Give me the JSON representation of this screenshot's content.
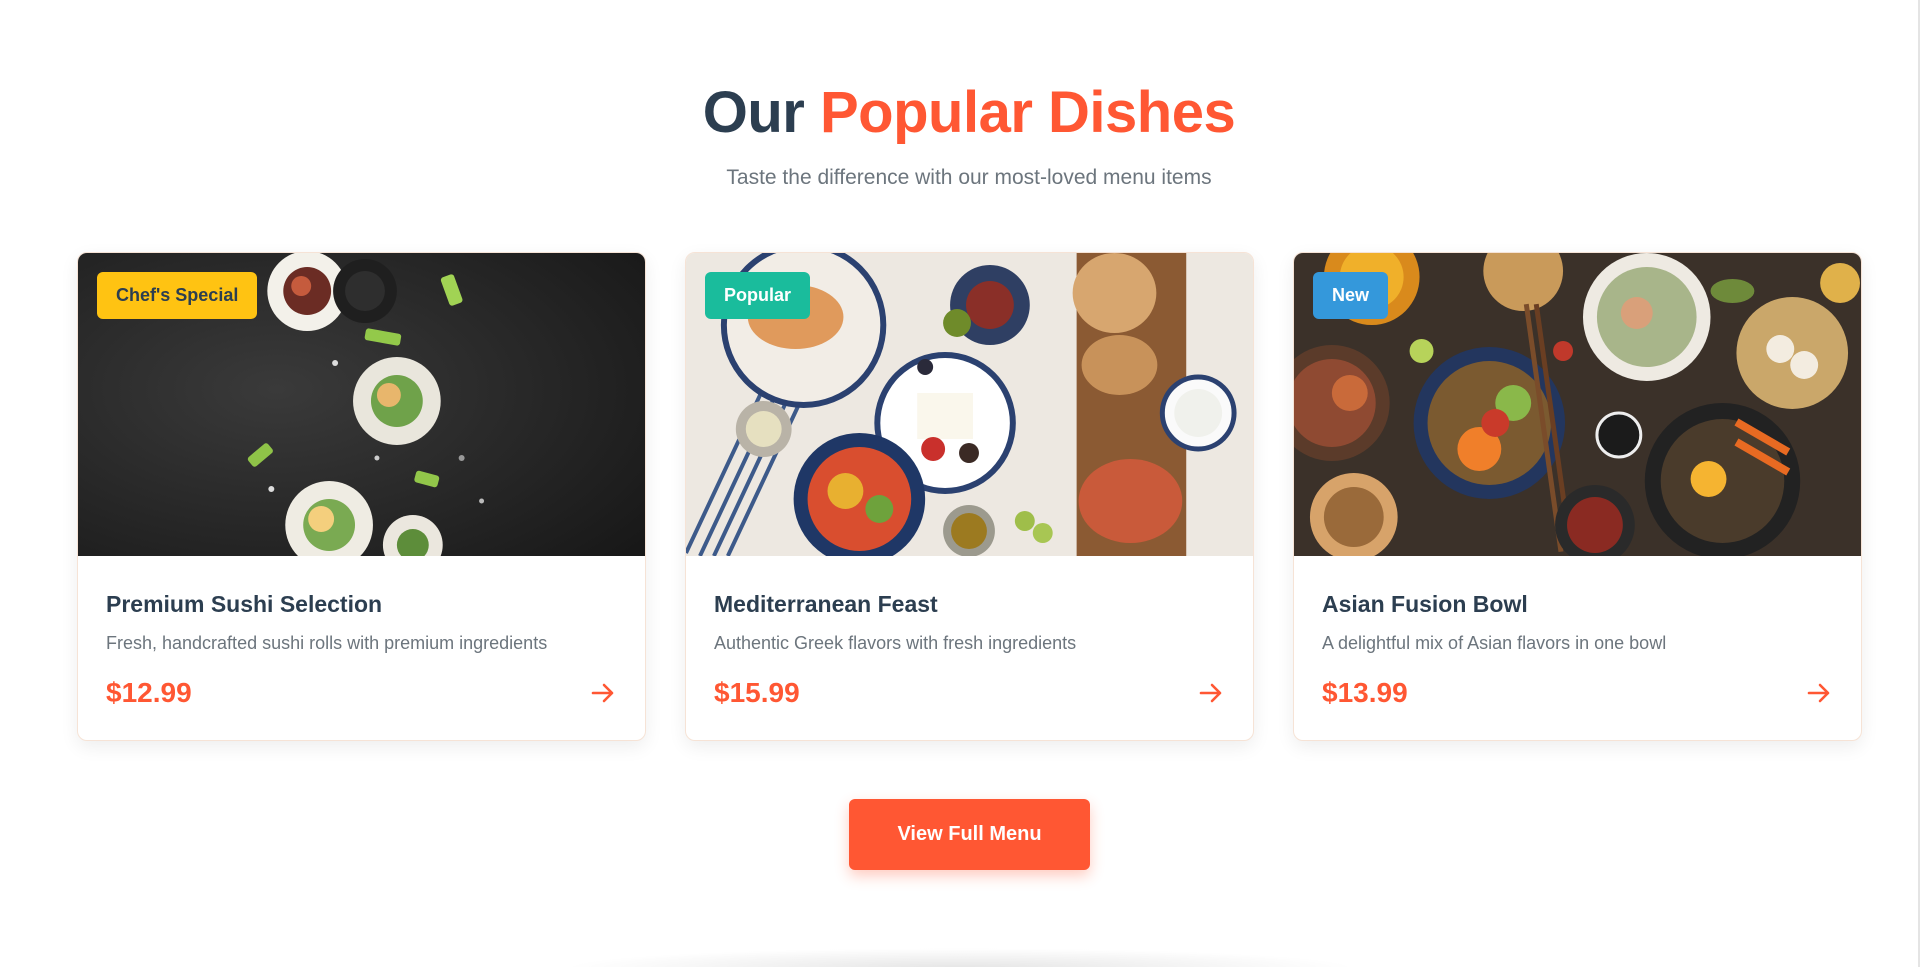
{
  "section": {
    "title_dark": "Our",
    "title_accent": "Popular Dishes",
    "subtitle": "Taste the difference with our most-loved menu items"
  },
  "colors": {
    "accent": "#ff5733",
    "heading": "#2c3e50",
    "muted": "#6c757d",
    "badge_chef": "#ffc312",
    "badge_popular": "#1abc9c",
    "badge_new": "#3498db"
  },
  "dishes": [
    {
      "badge": "Chef's Special",
      "title": "Premium Sushi Selection",
      "description": "Fresh, handcrafted sushi rolls with premium ingredients",
      "price": "$12.99",
      "action_icon": "arrow-right-icon"
    },
    {
      "badge": "Popular",
      "title": "Mediterranean Feast",
      "description": "Authentic Greek flavors with fresh ingredients",
      "price": "$15.99",
      "action_icon": "arrow-right-icon"
    },
    {
      "badge": "New",
      "title": "Asian Fusion Bowl",
      "description": "A delightful mix of Asian flavors in one bowl",
      "price": "$13.99",
      "action_icon": "arrow-right-icon"
    }
  ],
  "cta": {
    "label": "View Full Menu"
  }
}
